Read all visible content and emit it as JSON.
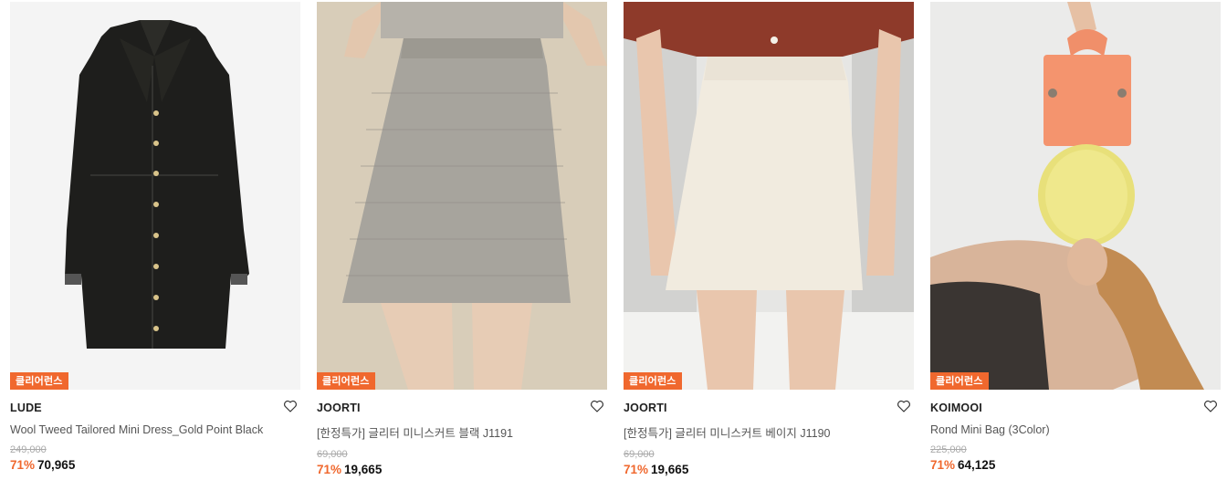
{
  "products": [
    {
      "badge": "클리어런스",
      "brand": "LUDE",
      "name": "Wool Tweed Tailored Mini Dress_Gold Point Black",
      "original_price": "249,000",
      "discount": "71%",
      "price": "70,965",
      "image": "black-tweed-dress"
    },
    {
      "badge": "클리어런스",
      "brand": "JOORTI",
      "name": "[한정특가] 글리터 미니스커트 블랙 J1191",
      "original_price": "69,000",
      "discount": "71%",
      "price": "19,665",
      "image": "gray-check-skirt"
    },
    {
      "badge": "클리어런스",
      "brand": "JOORTI",
      "name": "[한정특가] 글리터 미니스커트 베이지 J1190",
      "original_price": "69,000",
      "discount": "71%",
      "price": "19,665",
      "image": "beige-skirt"
    },
    {
      "badge": "클리어런스",
      "brand": "KOIMOOI",
      "name": "Rond Mini Bag (3Color)",
      "original_price": "225,000",
      "discount": "71%",
      "price": "64,125",
      "image": "orange-mini-bag"
    }
  ],
  "colors": {
    "badge": "#f0682e",
    "discount": "#f0682e"
  },
  "icons": {
    "wishlist": "heart-icon"
  }
}
